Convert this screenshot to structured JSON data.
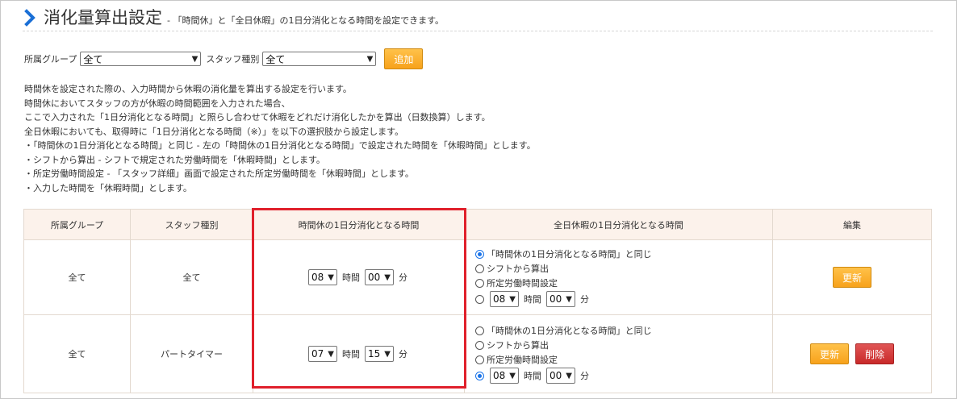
{
  "header": {
    "title": "消化量算出設定",
    "subtitle": "- 「時間休」と「全日休暇」の1日分消化となる時間を設定できます。"
  },
  "filter": {
    "group_label": "所属グループ",
    "group_value": "全て",
    "staff_label": "スタッフ種別",
    "staff_value": "全て",
    "add_button": "追加"
  },
  "description": [
    "時間休を設定された際の、入力時間から休暇の消化量を算出する設定を行います。",
    "時間休においてスタッフの方が休暇の時間範囲を入力された場合、",
    "ここで入力された「1日分消化となる時間」と照らし合わせて休暇をどれだけ消化したかを算出（日数換算）します。",
    "全日休暇においても、取得時に「1日分消化となる時間（※）」を以下の選択肢から設定します。",
    "・「時間休の1日分消化となる時間」と同じ - 左の「時間休の1日分消化となる時間」で設定された時間を「休暇時間」とします。",
    "・シフトから算出 - シフトで規定された労働時間を「休暇時間」とします。",
    "・所定労働時間設定 - 「スタッフ詳細」画面で設定された所定労働時間を「休暇時間」とします。",
    "・入力した時間を「休暇時間」とします。"
  ],
  "table": {
    "headers": [
      "所属グループ",
      "スタッフ種別",
      "時間休の1日分消化となる時間",
      "全日休暇の1日分消化となる時間",
      "編集"
    ],
    "hour_unit": "時間",
    "minute_unit": "分",
    "options": [
      "「時間休の1日分消化となる時間」と同じ",
      "シフトから算出",
      "所定労働時間設定"
    ],
    "update_label": "更新",
    "delete_label": "削除",
    "rows": [
      {
        "group": "全て",
        "staff": "全て",
        "hour": "08",
        "minute": "00",
        "full_hour": "08",
        "full_minute": "00",
        "selected_option": 0
      },
      {
        "group": "全て",
        "staff": "パートタイマー",
        "hour": "07",
        "minute": "15",
        "full_hour": "08",
        "full_minute": "00",
        "selected_option": 3
      }
    ]
  },
  "icons": {
    "header_chevron": "chevron-right-icon"
  },
  "colors": {
    "accent": "#1a6fd6",
    "button_orange": "#f7a21b",
    "button_red": "#c92a2a",
    "highlight_red": "#e0202b",
    "header_bg": "#fcf2eb"
  }
}
